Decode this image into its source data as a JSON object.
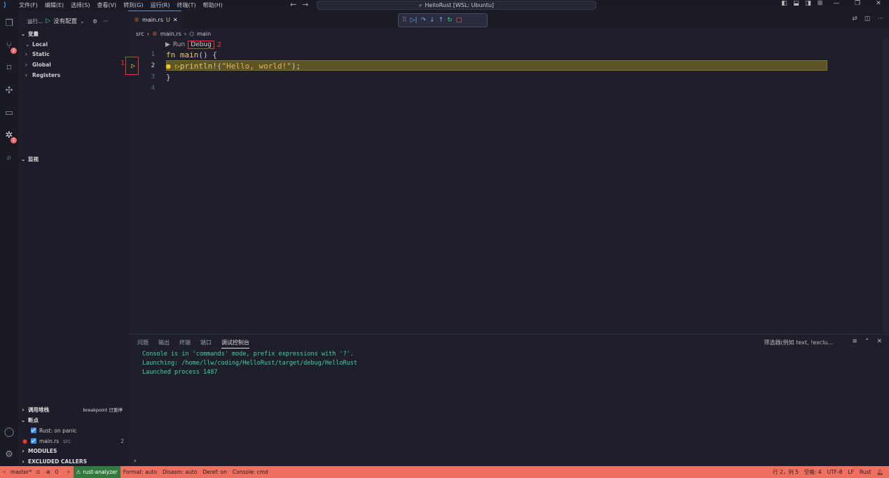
{
  "titlebar": {
    "menu": [
      "文件(F)",
      "编辑(E)",
      "选择(S)",
      "查看(V)",
      "转到(G)",
      "运行(R)",
      "终端(T)",
      "帮助(H)"
    ],
    "search": "HelloRust [WSL: Ubuntu]"
  },
  "sidebar": {
    "run_label": "运行...",
    "config": "没有配置",
    "variables_header": "变量",
    "variables": [
      "Local",
      "Static",
      "Global",
      "Registers"
    ],
    "watch_header": "监视",
    "callstack_header": "调用堆栈",
    "callstack_status": "breakpoint 已暂停",
    "breakpoints_header": "断点",
    "breakpoints": [
      {
        "label": "Rust: on panic",
        "path": "",
        "line": ""
      },
      {
        "label": "main.rs",
        "path": "src",
        "line": "2"
      }
    ],
    "modules_header": "MODULES",
    "excluded_header": "EXCLUDED CALLERS"
  },
  "editor": {
    "tab": {
      "name": "main.rs",
      "status": "U"
    },
    "breadcrumb": [
      "src",
      "main.rs",
      "main"
    ],
    "codelens": {
      "run": "Run",
      "debug": "Debug"
    },
    "annotations": {
      "gutter": "1",
      "debug": "2"
    },
    "lines": [
      {
        "n": "1",
        "text": "fn main() {"
      },
      {
        "n": "2",
        "text": "println!(\"Hello, world!\");"
      },
      {
        "n": "3",
        "text": "}"
      },
      {
        "n": "4",
        "text": ""
      }
    ]
  },
  "panel": {
    "tabs": [
      "问题",
      "输出",
      "终端",
      "端口",
      "调试控制台"
    ],
    "filter": "筛选器(例如 text, !exclu...",
    "console": [
      "Console is in 'commands' mode, prefix expressions with '?'.",
      "Launching: /home/llw/coding/HelloRust/target/debug/HelloRust",
      "Launched process 1487"
    ]
  },
  "statusbar": {
    "branch": "master*",
    "errors": "0",
    "analyzer": "rust-analyzer",
    "items": [
      "Format: auto",
      "Disasm: auto",
      "Deref: on",
      "Console: cmd"
    ],
    "position": "行 2，列 5",
    "spaces": "空格: 4",
    "encoding": "UTF-8",
    "eol": "LF",
    "language": "Rust"
  }
}
